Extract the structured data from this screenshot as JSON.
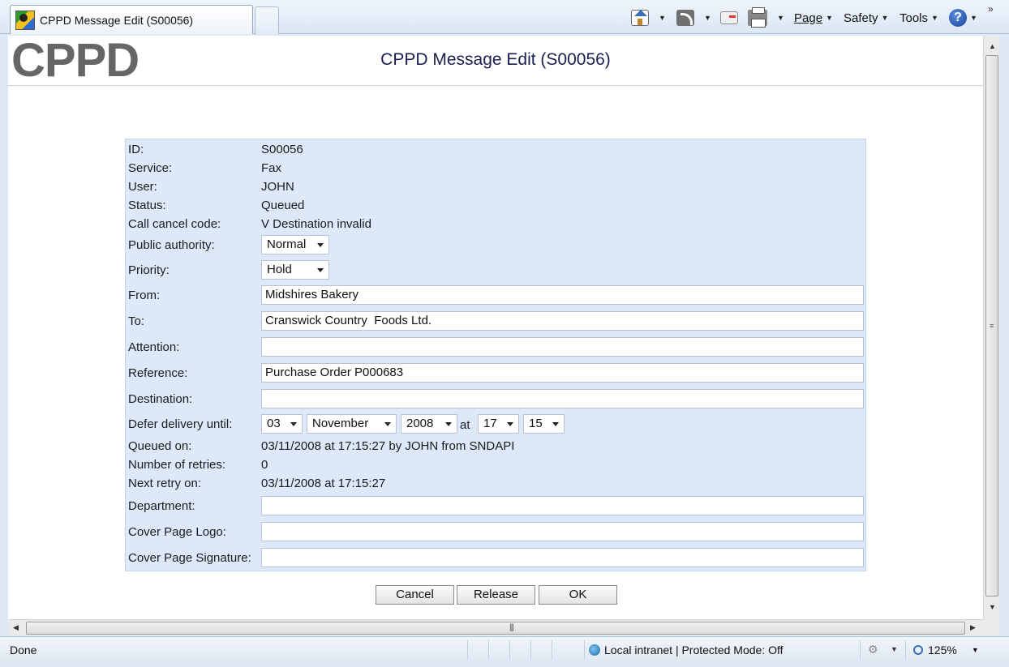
{
  "browser": {
    "tab_title": "CPPD Message Edit (S00056)",
    "toolbar": {
      "page_label": "Page",
      "safety_label": "Safety",
      "tools_label": "Tools",
      "help_glyph": "?"
    },
    "status": {
      "left": "Done",
      "zone": "Local intranet | Protected Mode: Off",
      "zoom": "125%"
    }
  },
  "header": {
    "logo": "CPPD",
    "title": "CPPD Message Edit (S00056)"
  },
  "form": {
    "id_label": "ID:",
    "id_value": "S00056",
    "service_label": "Service:",
    "service_value": "Fax",
    "user_label": "User:",
    "user_value": "JOHN",
    "status_label": "Status:",
    "status_value": "Queued",
    "cancel_code_label": "Call cancel code:",
    "cancel_code_value": "V Destination invalid",
    "public_authority_label": "Public authority:",
    "public_authority_value": "Normal",
    "priority_label": "Priority:",
    "priority_value": "Hold",
    "from_label": "From:",
    "from_value": "Midshires Bakery",
    "to_label": "To:",
    "to_value": "Cranswick Country  Foods Ltd.",
    "attention_label": "Attention:",
    "attention_value": "",
    "reference_label": "Reference:",
    "reference_value": "Purchase Order P000683",
    "destination_label": "Destination:",
    "destination_value": "",
    "defer_label": "Defer delivery until:",
    "defer_day": "03",
    "defer_month": "November",
    "defer_year": "2008",
    "defer_at": "at",
    "defer_hour": "17",
    "defer_minute": "15",
    "queued_on_label": "Queued on:",
    "queued_on_value": "03/11/2008 at 17:15:27 by JOHN from SNDAPI",
    "retries_label": "Number of retries:",
    "retries_value": "0",
    "next_retry_label": "Next retry on:",
    "next_retry_value": "03/11/2008 at 17:15:27",
    "department_label": "Department:",
    "department_value": "",
    "cover_logo_label": "Cover Page Logo:",
    "cover_logo_value": "",
    "cover_signature_label": "Cover Page Signature:",
    "cover_signature_value": ""
  },
  "buttons": {
    "cancel": "Cancel",
    "release": "Release",
    "ok": "OK"
  },
  "icons": [
    "home-icon",
    "rss-feed-icon",
    "read-mail-icon",
    "print-icon",
    "help-icon",
    "globe-icon",
    "zoom-icon"
  ]
}
